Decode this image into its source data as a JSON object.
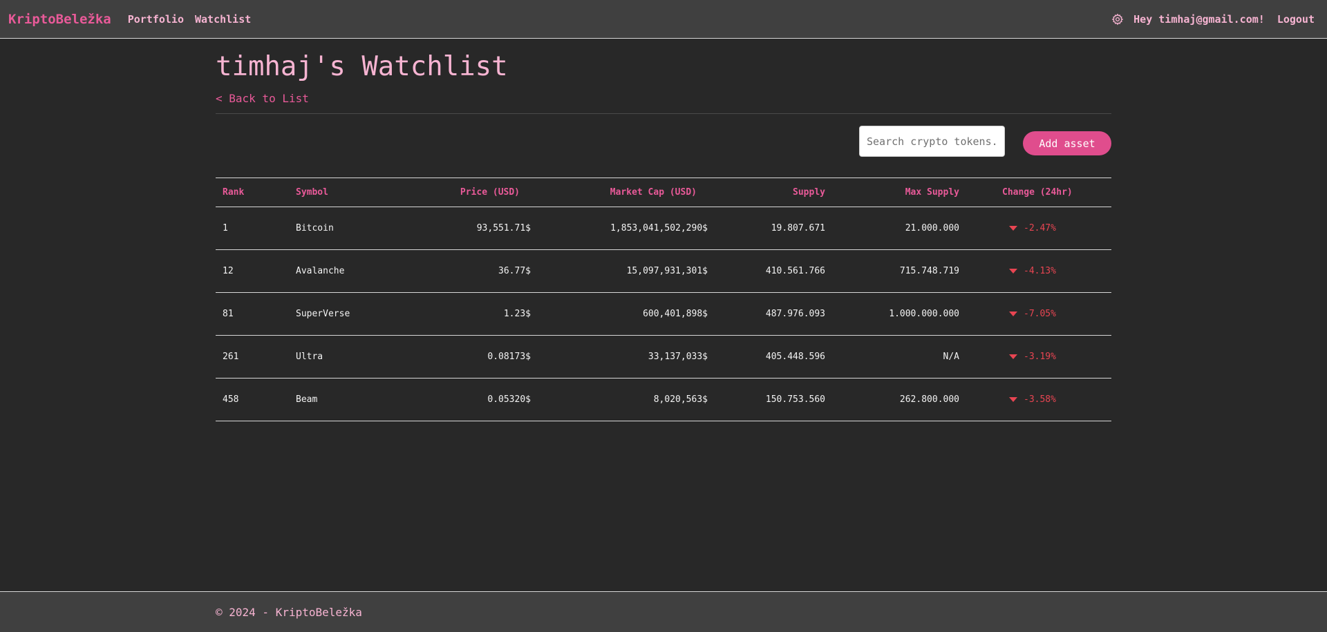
{
  "nav": {
    "brand": "KriptoBeležka",
    "links": [
      "Portfolio",
      "Watchlist"
    ],
    "greeting": "Hey timhaj@gmail.com!",
    "logout": "Logout",
    "settings_icon": "gear-icon"
  },
  "page": {
    "title": "timhaj's Watchlist",
    "back": "< Back to List"
  },
  "toolbar": {
    "search_placeholder": "Search crypto tokens...",
    "add_label": "Add asset"
  },
  "table": {
    "headers": [
      "Rank",
      "Symbol",
      "Price (USD)",
      "Market Cap (USD)",
      "Supply",
      "Max Supply",
      "Change (24hr)"
    ],
    "rows": [
      {
        "rank": "1",
        "symbol": "Bitcoin",
        "price": "93,551.71$",
        "mcap": "1,853,041,502,290$",
        "supply": "19.807.671",
        "max": "21.000.000",
        "change": "-2.47%"
      },
      {
        "rank": "12",
        "symbol": "Avalanche",
        "price": "36.77$",
        "mcap": "15,097,931,301$",
        "supply": "410.561.766",
        "max": "715.748.719",
        "change": "-4.13%"
      },
      {
        "rank": "81",
        "symbol": "SuperVerse",
        "price": "1.23$",
        "mcap": "600,401,898$",
        "supply": "487.976.093",
        "max": "1.000.000.000",
        "change": "-7.05%"
      },
      {
        "rank": "261",
        "symbol": "Ultra",
        "price": "0.08173$",
        "mcap": "33,137,033$",
        "supply": "405.448.596",
        "max": "N/A",
        "change": "-3.19%"
      },
      {
        "rank": "458",
        "symbol": "Beam",
        "price": "0.05320$",
        "mcap": "8,020,563$",
        "supply": "150.753.560",
        "max": "262.800.000",
        "change": "-3.58%"
      }
    ],
    "change_icon": "caret-down-icon"
  },
  "footer": {
    "text": "© 2024 - KriptoBeležka"
  },
  "colors": {
    "accent": "#e95a99",
    "accent_light": "#f7b4d2",
    "button": "#e04d8d",
    "negative": "#e84552",
    "background": "#282828",
    "bar": "#404040"
  }
}
